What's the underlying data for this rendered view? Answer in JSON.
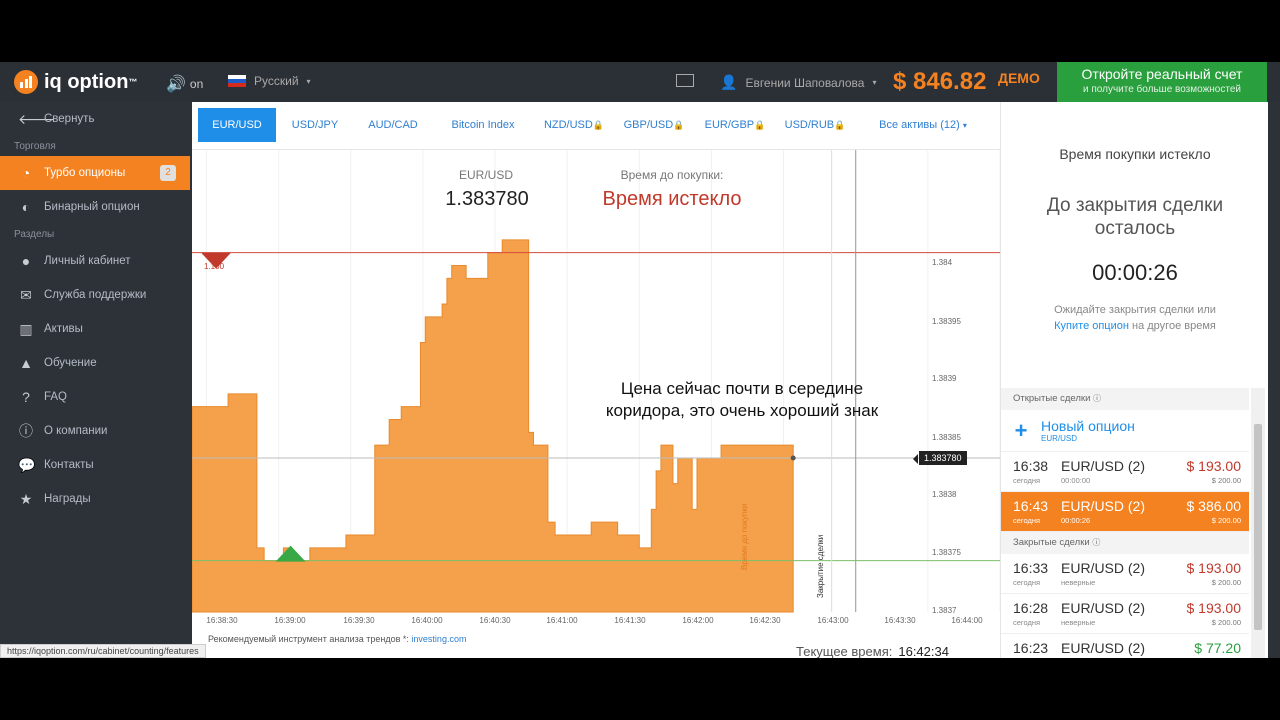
{
  "topbar": {
    "logo": "iq option",
    "logo_tm": "™",
    "sound_label": "on",
    "language": "Русский",
    "user_name": "Евгении Шаповалова",
    "balance": "$ 846.82",
    "demo_label": "ДЕМО",
    "cta_title": "Откройте реальный счет",
    "cta_sub": "и получите больше возможностей"
  },
  "sidebar": {
    "collapse": "Свернуть",
    "section_trade": "Торговля",
    "turbo": "Турбо опционы",
    "turbo_badge": "2",
    "binary": "Бинарный опцион",
    "section_pages": "Разделы",
    "cabinet": "Личный кабинет",
    "support": "Служба поддержки",
    "assets": "Активы",
    "learning": "Обучение",
    "faq": "FAQ",
    "about": "О компании",
    "contacts": "Контакты",
    "awards": "Награды"
  },
  "tabs": [
    {
      "label": "EUR/USD"
    },
    {
      "label": "USD/JPY"
    },
    {
      "label": "AUD/CAD"
    },
    {
      "label": "Bitcoin Index"
    },
    {
      "label": "NZD/USD"
    },
    {
      "label": "GBP/USD"
    },
    {
      "label": "EUR/GBP"
    },
    {
      "label": "USD/RUB"
    },
    {
      "label": "Все активы (12)"
    }
  ],
  "chart": {
    "pair": "EUR/USD",
    "price": "1.383780",
    "expiry_label": "Время до покупки:",
    "expiry_value": "Время истекло",
    "annotation_line1": "Цена сейчас почти в середине",
    "annotation_line2": "коридора, это очень хороший знак",
    "price_tag": "1.383780",
    "red_level_label": "1.100",
    "y_labels": [
      "1.384",
      "1.38395",
      "1.3839",
      "1.38385",
      "1.3838",
      "1.38375",
      "1.3837"
    ],
    "x_labels": [
      "16:38:30",
      "16:39:00",
      "16:39:30",
      "16:40:00",
      "16:40:30",
      "16:41:00",
      "16:41:30",
      "16:42:00",
      "16:42:30",
      "16:43:00",
      "16:43:30",
      "16:44:00"
    ],
    "vline_purchase": "Время до покупки",
    "vline_close": "Закрытие сделки",
    "recommend_text": "Рекомендуемый инструмент анализа трендов *:",
    "recommend_link": "investing.com",
    "current_time_label": "Текущее время:",
    "current_time": "16:42:34",
    "series_color": "#f5a04a",
    "series": [
      [
        "16:38:24",
        1.38382
      ],
      [
        "16:38:37",
        1.38382
      ],
      [
        "16:38:39",
        1.38383
      ],
      [
        "16:38:47",
        1.38383
      ],
      [
        "16:38:50",
        1.38383
      ],
      [
        "16:38:51",
        1.38371
      ],
      [
        "16:38:54",
        1.3837
      ],
      [
        "16:38:57",
        1.3837
      ],
      [
        "16:39:02",
        1.38371
      ],
      [
        "16:39:05",
        1.3837
      ],
      [
        "16:39:11",
        1.3837
      ],
      [
        "16:39:13",
        1.38371
      ],
      [
        "16:39:17",
        1.38371
      ],
      [
        "16:39:24",
        1.38371
      ],
      [
        "16:39:28",
        1.38372
      ],
      [
        "16:39:32",
        1.38372
      ],
      [
        "16:39:35",
        1.38372
      ],
      [
        "16:39:40",
        1.38379
      ],
      [
        "16:39:43",
        1.38379
      ],
      [
        "16:39:46",
        1.38381
      ],
      [
        "16:39:49",
        1.38381
      ],
      [
        "16:39:51",
        1.38382
      ],
      [
        "16:39:57",
        1.38382
      ],
      [
        "16:39:59",
        1.38387
      ],
      [
        "16:40:01",
        1.38389
      ],
      [
        "16:40:08",
        1.3839
      ],
      [
        "16:40:10",
        1.38392
      ],
      [
        "16:40:12",
        1.38393
      ],
      [
        "16:40:17",
        1.38393
      ],
      [
        "16:40:18",
        1.38392
      ],
      [
        "16:40:25",
        1.38392
      ],
      [
        "16:40:27",
        1.38394
      ],
      [
        "16:40:30",
        1.38394
      ],
      [
        "16:40:33",
        1.38395
      ],
      [
        "16:40:40",
        1.38395
      ],
      [
        "16:40:44",
        1.3838
      ],
      [
        "16:40:46",
        1.38379
      ],
      [
        "16:40:49",
        1.38379
      ],
      [
        "16:40:52",
        1.38373
      ],
      [
        "16:40:55",
        1.38372
      ],
      [
        "16:41:07",
        1.38372
      ],
      [
        "16:41:10",
        1.38373
      ],
      [
        "16:41:18",
        1.38373
      ],
      [
        "16:41:21",
        1.38372
      ],
      [
        "16:41:27",
        1.38372
      ],
      [
        "16:41:30",
        1.38371
      ],
      [
        "16:41:35",
        1.38374
      ],
      [
        "16:41:37",
        1.38377
      ],
      [
        "16:41:39",
        1.38379
      ],
      [
        "16:41:41",
        1.38379
      ],
      [
        "16:41:44",
        1.38376
      ],
      [
        "16:41:46",
        1.38378
      ],
      [
        "16:41:49",
        1.38378
      ],
      [
        "16:41:52",
        1.38374
      ],
      [
        "16:41:54",
        1.38378
      ],
      [
        "16:41:57",
        1.38378
      ],
      [
        "16:42:04",
        1.38379
      ],
      [
        "16:42:13",
        1.38379
      ],
      [
        "16:42:24",
        1.38379
      ],
      [
        "16:42:29",
        1.38379
      ],
      [
        "16:42:34",
        1.38378
      ]
    ],
    "entry_markers": [
      {
        "t": "16:38:34",
        "price": 1.38394,
        "dir": "down",
        "color": "#c0392b"
      },
      {
        "t": "16:39:05",
        "price": 1.3837,
        "dir": "up",
        "color": "#3aa845"
      }
    ]
  },
  "chart_data": {
    "type": "area",
    "x_range": [
      "16:38:24",
      "16:44:00"
    ],
    "ylim": [
      1.38366,
      1.38402
    ],
    "yticks": [
      1.3837,
      1.38375,
      1.3838,
      1.38385,
      1.3839,
      1.38395,
      1.384
    ],
    "current_price": 1.38378,
    "red_level": 1.38394,
    "green_level": 1.3837
  },
  "rpanel": {
    "title": "Время покупки истекло",
    "close_line1": "До закрытия сделки",
    "close_line2": "осталось",
    "timer": "00:00:26",
    "wait_text": "Ожидайте закрытия сделки или",
    "wait_link": "Купите опцион",
    "wait_tail": "на другое время",
    "open_head": "Открытые сделки",
    "new_option": "Новый опцион",
    "new_option_sub": "EUR/USD",
    "closed_head": "Закрытые сделки",
    "deals_open": [
      {
        "time": "16:38",
        "sub": "сегодня",
        "pair": "EUR/USD (2)",
        "sub2": "00:00:00",
        "amount": "$ 193.00",
        "amount2": "$ 200.00",
        "active": false
      },
      {
        "time": "16:43",
        "sub": "сегодня",
        "pair": "EUR/USD (2)",
        "sub2": "00:00:26",
        "amount": "$ 386.00",
        "amount2": "$ 200.00",
        "active": true
      }
    ],
    "deals_closed": [
      {
        "time": "16:33",
        "sub": "сегодня",
        "pair": "EUR/USD (2)",
        "sub2": "неверные",
        "amount": "$ 193.00",
        "amount2": "$ 200.00",
        "green": false
      },
      {
        "time": "16:28",
        "sub": "сегодня",
        "pair": "EUR/USD (2)",
        "sub2": "неверные",
        "amount": "$ 193.00",
        "amount2": "$ 200.00",
        "green": false
      },
      {
        "time": "16:23",
        "sub": "сегодня",
        "pair": "EUR/USD (2)",
        "sub2": "",
        "amount": "$ 77.20",
        "amount2": "",
        "green": true
      }
    ]
  },
  "status_url": "https://iqoption.com/ru/cabinet/counting/features"
}
